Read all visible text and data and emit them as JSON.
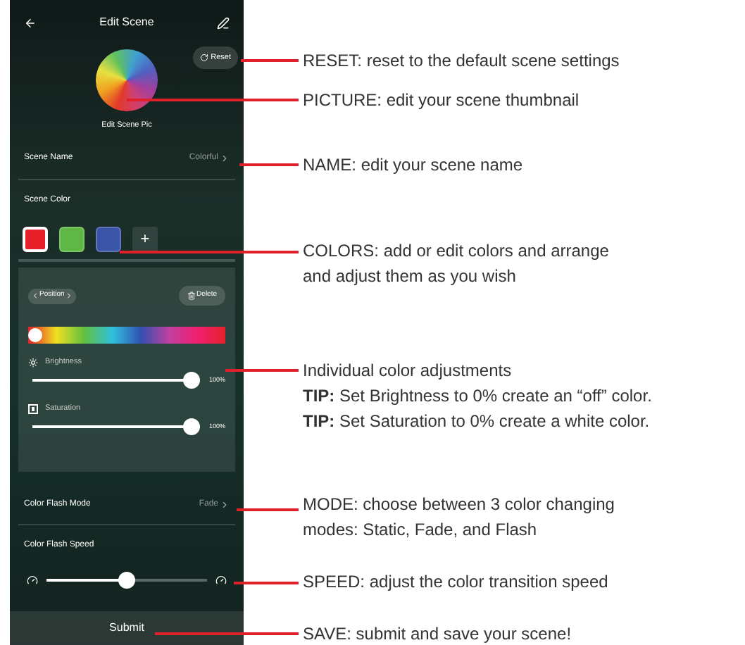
{
  "header": {
    "title": "Edit Scene"
  },
  "reset_button": "Reset",
  "scene_pic_label": "Edit Scene Pic",
  "scene_name": {
    "label": "Scene Name",
    "value": "Colorful"
  },
  "scene_color": {
    "label": "Scene Color",
    "add": "+",
    "swatches": [
      {
        "color": "#e8202a",
        "selected": true
      },
      {
        "color": "#5fb846",
        "selected": false
      },
      {
        "color": "#3a55a8",
        "selected": false
      }
    ]
  },
  "color_editor": {
    "position": "Position",
    "delete": "Delete",
    "hue_bar": {
      "level": 0
    },
    "sliders": [
      {
        "kind": "brightness",
        "label": "Brightness",
        "level": 1,
        "reading": "100%"
      },
      {
        "kind": "saturation",
        "label": "Saturation",
        "level": 1,
        "reading": "100%"
      }
    ]
  },
  "flash_mode": {
    "label": "Color Flash Mode",
    "value": "Fade"
  },
  "flash_speed": {
    "label": "Color Flash Speed",
    "level": 0.5
  },
  "submit": "Submit",
  "callouts": [
    {
      "lines": [
        "RESET: reset to the default scene settings"
      ]
    },
    {
      "lines": [
        "PICTURE: edit your scene thumbnail"
      ]
    },
    {
      "lines": [
        "NAME: edit your scene name"
      ]
    },
    {
      "lines": [
        "COLORS: add or edit colors and arrange",
        "and adjust them as you wish"
      ]
    },
    {
      "lines": [
        "Individual color adjustments",
        "**TIP:** Set Brightness to 0% create an “off” color.",
        "**TIP:** Set Saturation to 0% create a white color."
      ]
    },
    {
      "lines": [
        "MODE: choose between 3 color changing",
        "modes: Static, Fade, and Flash"
      ]
    },
    {
      "lines": [
        "SPEED: adjust the color transition speed"
      ]
    },
    {
      "lines": [
        "SAVE: submit and save your scene!"
      ]
    }
  ]
}
